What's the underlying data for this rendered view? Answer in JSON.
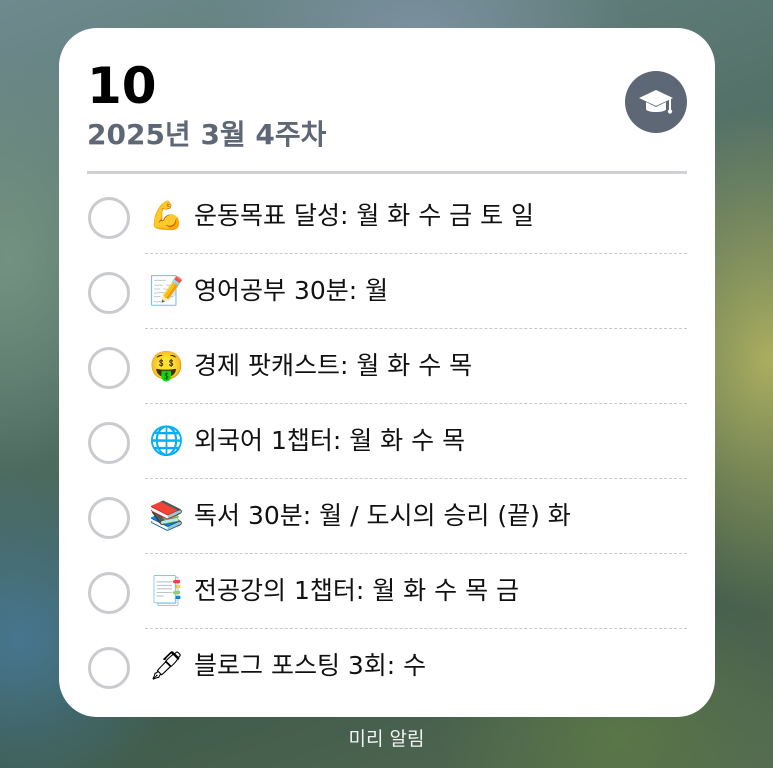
{
  "widget": {
    "day": "10",
    "week_label": "2025년 3월 4주차",
    "badge_icon": "graduation-cap-icon",
    "colors": {
      "badge": "#5d6775",
      "checkbox_border": "#c9cbcf",
      "subtitle": "#5d6775"
    },
    "tasks": [
      {
        "emoji": "💪",
        "icon": "flexed-biceps-icon",
        "label": "운동목표 달성: 월 화 수 금 토 일",
        "done": false
      },
      {
        "emoji": "📝",
        "icon": "memo-icon",
        "label": "영어공부 30분: 월",
        "done": false
      },
      {
        "emoji": "🤑",
        "icon": "money-mouth-face-icon",
        "label": "경제 팟캐스트: 월 화 수 목",
        "done": false
      },
      {
        "emoji": "🌐",
        "icon": "globe-icon",
        "label": "외국어 1챕터: 월 화 수 목",
        "done": false
      },
      {
        "emoji": "📚",
        "icon": "books-icon",
        "label": "독서 30분: 월 / 도시의 승리 (끝) 화",
        "done": false
      },
      {
        "emoji": "📑",
        "icon": "bookmark-tabs-icon",
        "label": "전공강의 1챕터: 월 화 수 목 금",
        "done": false
      },
      {
        "emoji": "🖋",
        "icon": "fountain-pen-icon",
        "label": "블로그 포스팅 3회: 수",
        "done": false
      }
    ]
  },
  "caption": "미리 알림"
}
